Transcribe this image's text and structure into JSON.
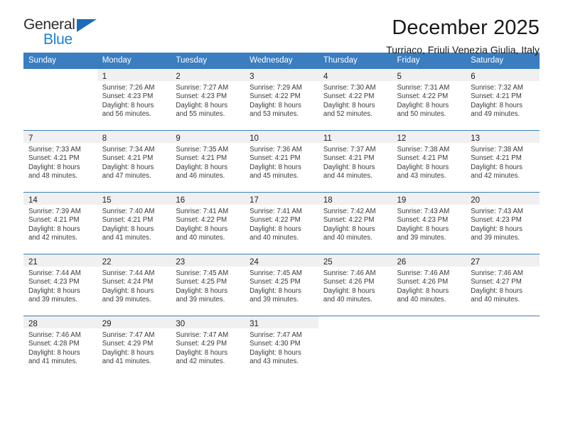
{
  "brand": {
    "name_part1": "General",
    "name_part2": "Blue",
    "logo_icon": "triangle-logo-icon",
    "accent_color": "#1b7fd4",
    "triangle_color": "#1d6cb5"
  },
  "header": {
    "title": "December 2025",
    "subtitle": "Turriaco, Friuli Venezia Giulia, Italy"
  },
  "theme": {
    "header_row_bg": "#3a7dc0",
    "header_row_text": "#ffffff",
    "daynum_bg": "#f0f0f0",
    "grid_line": "#3a7dc0"
  },
  "weekdays": [
    "Sunday",
    "Monday",
    "Tuesday",
    "Wednesday",
    "Thursday",
    "Friday",
    "Saturday"
  ],
  "weeks": [
    [
      {
        "empty": true
      },
      {
        "day": "1",
        "sunrise": "Sunrise: 7:26 AM",
        "sunset": "Sunset: 4:23 PM",
        "daylight_line1": "Daylight: 8 hours",
        "daylight_line2": "and 56 minutes."
      },
      {
        "day": "2",
        "sunrise": "Sunrise: 7:27 AM",
        "sunset": "Sunset: 4:23 PM",
        "daylight_line1": "Daylight: 8 hours",
        "daylight_line2": "and 55 minutes."
      },
      {
        "day": "3",
        "sunrise": "Sunrise: 7:29 AM",
        "sunset": "Sunset: 4:22 PM",
        "daylight_line1": "Daylight: 8 hours",
        "daylight_line2": "and 53 minutes."
      },
      {
        "day": "4",
        "sunrise": "Sunrise: 7:30 AM",
        "sunset": "Sunset: 4:22 PM",
        "daylight_line1": "Daylight: 8 hours",
        "daylight_line2": "and 52 minutes."
      },
      {
        "day": "5",
        "sunrise": "Sunrise: 7:31 AM",
        "sunset": "Sunset: 4:22 PM",
        "daylight_line1": "Daylight: 8 hours",
        "daylight_line2": "and 50 minutes."
      },
      {
        "day": "6",
        "sunrise": "Sunrise: 7:32 AM",
        "sunset": "Sunset: 4:21 PM",
        "daylight_line1": "Daylight: 8 hours",
        "daylight_line2": "and 49 minutes."
      }
    ],
    [
      {
        "day": "7",
        "sunrise": "Sunrise: 7:33 AM",
        "sunset": "Sunset: 4:21 PM",
        "daylight_line1": "Daylight: 8 hours",
        "daylight_line2": "and 48 minutes."
      },
      {
        "day": "8",
        "sunrise": "Sunrise: 7:34 AM",
        "sunset": "Sunset: 4:21 PM",
        "daylight_line1": "Daylight: 8 hours",
        "daylight_line2": "and 47 minutes."
      },
      {
        "day": "9",
        "sunrise": "Sunrise: 7:35 AM",
        "sunset": "Sunset: 4:21 PM",
        "daylight_line1": "Daylight: 8 hours",
        "daylight_line2": "and 46 minutes."
      },
      {
        "day": "10",
        "sunrise": "Sunrise: 7:36 AM",
        "sunset": "Sunset: 4:21 PM",
        "daylight_line1": "Daylight: 8 hours",
        "daylight_line2": "and 45 minutes."
      },
      {
        "day": "11",
        "sunrise": "Sunrise: 7:37 AM",
        "sunset": "Sunset: 4:21 PM",
        "daylight_line1": "Daylight: 8 hours",
        "daylight_line2": "and 44 minutes."
      },
      {
        "day": "12",
        "sunrise": "Sunrise: 7:38 AM",
        "sunset": "Sunset: 4:21 PM",
        "daylight_line1": "Daylight: 8 hours",
        "daylight_line2": "and 43 minutes."
      },
      {
        "day": "13",
        "sunrise": "Sunrise: 7:38 AM",
        "sunset": "Sunset: 4:21 PM",
        "daylight_line1": "Daylight: 8 hours",
        "daylight_line2": "and 42 minutes."
      }
    ],
    [
      {
        "day": "14",
        "sunrise": "Sunrise: 7:39 AM",
        "sunset": "Sunset: 4:21 PM",
        "daylight_line1": "Daylight: 8 hours",
        "daylight_line2": "and 42 minutes."
      },
      {
        "day": "15",
        "sunrise": "Sunrise: 7:40 AM",
        "sunset": "Sunset: 4:21 PM",
        "daylight_line1": "Daylight: 8 hours",
        "daylight_line2": "and 41 minutes."
      },
      {
        "day": "16",
        "sunrise": "Sunrise: 7:41 AM",
        "sunset": "Sunset: 4:22 PM",
        "daylight_line1": "Daylight: 8 hours",
        "daylight_line2": "and 40 minutes."
      },
      {
        "day": "17",
        "sunrise": "Sunrise: 7:41 AM",
        "sunset": "Sunset: 4:22 PM",
        "daylight_line1": "Daylight: 8 hours",
        "daylight_line2": "and 40 minutes."
      },
      {
        "day": "18",
        "sunrise": "Sunrise: 7:42 AM",
        "sunset": "Sunset: 4:22 PM",
        "daylight_line1": "Daylight: 8 hours",
        "daylight_line2": "and 40 minutes."
      },
      {
        "day": "19",
        "sunrise": "Sunrise: 7:43 AM",
        "sunset": "Sunset: 4:23 PM",
        "daylight_line1": "Daylight: 8 hours",
        "daylight_line2": "and 39 minutes."
      },
      {
        "day": "20",
        "sunrise": "Sunrise: 7:43 AM",
        "sunset": "Sunset: 4:23 PM",
        "daylight_line1": "Daylight: 8 hours",
        "daylight_line2": "and 39 minutes."
      }
    ],
    [
      {
        "day": "21",
        "sunrise": "Sunrise: 7:44 AM",
        "sunset": "Sunset: 4:23 PM",
        "daylight_line1": "Daylight: 8 hours",
        "daylight_line2": "and 39 minutes."
      },
      {
        "day": "22",
        "sunrise": "Sunrise: 7:44 AM",
        "sunset": "Sunset: 4:24 PM",
        "daylight_line1": "Daylight: 8 hours",
        "daylight_line2": "and 39 minutes."
      },
      {
        "day": "23",
        "sunrise": "Sunrise: 7:45 AM",
        "sunset": "Sunset: 4:25 PM",
        "daylight_line1": "Daylight: 8 hours",
        "daylight_line2": "and 39 minutes."
      },
      {
        "day": "24",
        "sunrise": "Sunrise: 7:45 AM",
        "sunset": "Sunset: 4:25 PM",
        "daylight_line1": "Daylight: 8 hours",
        "daylight_line2": "and 39 minutes."
      },
      {
        "day": "25",
        "sunrise": "Sunrise: 7:46 AM",
        "sunset": "Sunset: 4:26 PM",
        "daylight_line1": "Daylight: 8 hours",
        "daylight_line2": "and 40 minutes."
      },
      {
        "day": "26",
        "sunrise": "Sunrise: 7:46 AM",
        "sunset": "Sunset: 4:26 PM",
        "daylight_line1": "Daylight: 8 hours",
        "daylight_line2": "and 40 minutes."
      },
      {
        "day": "27",
        "sunrise": "Sunrise: 7:46 AM",
        "sunset": "Sunset: 4:27 PM",
        "daylight_line1": "Daylight: 8 hours",
        "daylight_line2": "and 40 minutes."
      }
    ],
    [
      {
        "day": "28",
        "sunrise": "Sunrise: 7:46 AM",
        "sunset": "Sunset: 4:28 PM",
        "daylight_line1": "Daylight: 8 hours",
        "daylight_line2": "and 41 minutes."
      },
      {
        "day": "29",
        "sunrise": "Sunrise: 7:47 AM",
        "sunset": "Sunset: 4:29 PM",
        "daylight_line1": "Daylight: 8 hours",
        "daylight_line2": "and 41 minutes."
      },
      {
        "day": "30",
        "sunrise": "Sunrise: 7:47 AM",
        "sunset": "Sunset: 4:29 PM",
        "daylight_line1": "Daylight: 8 hours",
        "daylight_line2": "and 42 minutes."
      },
      {
        "day": "31",
        "sunrise": "Sunrise: 7:47 AM",
        "sunset": "Sunset: 4:30 PM",
        "daylight_line1": "Daylight: 8 hours",
        "daylight_line2": "and 43 minutes."
      },
      {
        "empty": true
      },
      {
        "empty": true
      },
      {
        "empty": true
      }
    ]
  ]
}
